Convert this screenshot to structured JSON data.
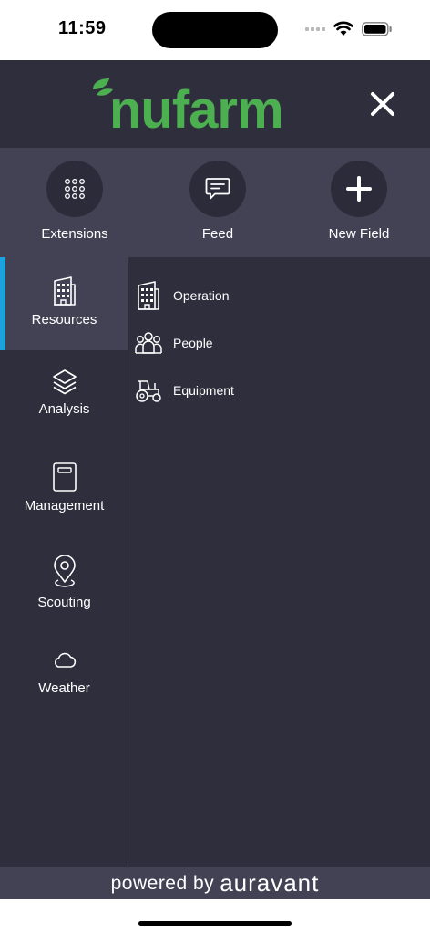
{
  "status": {
    "time": "11:59"
  },
  "header": {
    "logo_text": "nufarm",
    "brand_color": "#4caf50"
  },
  "quick_actions": [
    {
      "label": "Extensions",
      "icon": "grid-dots-icon"
    },
    {
      "label": "Feed",
      "icon": "chat-icon"
    },
    {
      "label": "New Field",
      "icon": "plus-icon"
    }
  ],
  "nav": [
    {
      "label": "Resources",
      "icon": "building-icon",
      "active": true
    },
    {
      "label": "Analysis",
      "icon": "layers-icon"
    },
    {
      "label": "Management",
      "icon": "notebook-icon"
    },
    {
      "label": "Scouting",
      "icon": "map-pin-icon"
    },
    {
      "label": "Weather",
      "icon": "cloud-icon"
    }
  ],
  "resources": [
    {
      "label": "Operation",
      "icon": "building-icon"
    },
    {
      "label": "People",
      "icon": "people-icon"
    },
    {
      "label": "Equipment",
      "icon": "tractor-icon"
    }
  ],
  "footer": {
    "prefix": "powered by",
    "brand": "auravant"
  },
  "colors": {
    "background": "#2f2e3d",
    "panel": "#434255",
    "accent": "#1ba3dd"
  }
}
